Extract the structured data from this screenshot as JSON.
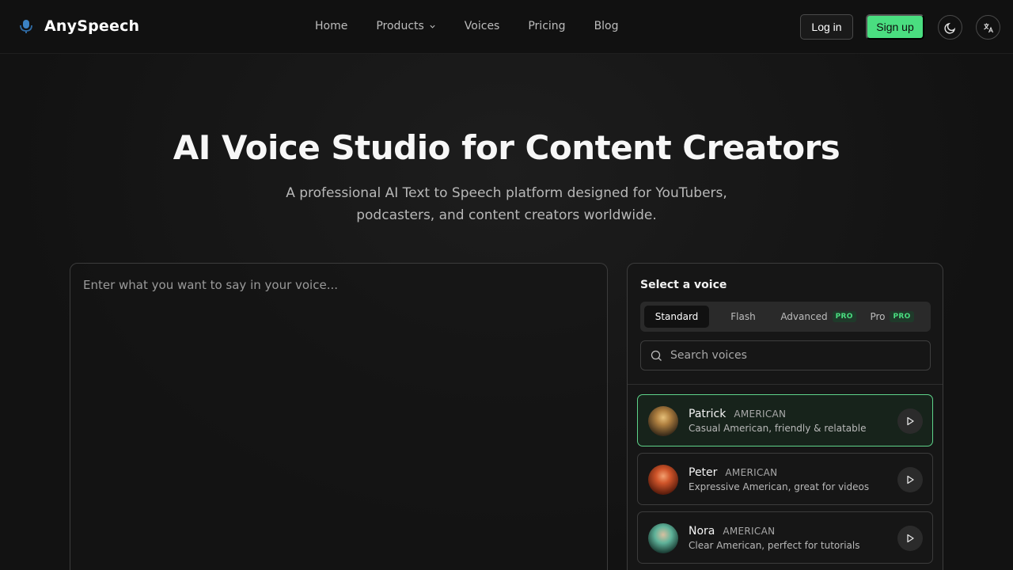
{
  "brand": {
    "name": "AnySpeech",
    "accent": "#4ade80"
  },
  "nav": {
    "items": [
      {
        "label": "Home"
      },
      {
        "label": "Products",
        "has_dropdown": true
      },
      {
        "label": "Voices"
      },
      {
        "label": "Pricing"
      },
      {
        "label": "Blog"
      }
    ]
  },
  "auth": {
    "login_label": "Log in",
    "signup_label": "Sign up"
  },
  "header_icons": {
    "theme": "moon-icon",
    "language": "translate-icon"
  },
  "hero": {
    "title": "AI Voice Studio for Content Creators",
    "subtitle": "A professional AI Text to Speech platform designed for YouTubers, podcasters, and content creators worldwide."
  },
  "editor": {
    "placeholder": "Enter what you want to say in your voice...",
    "value": ""
  },
  "voice_panel": {
    "title": "Select a voice",
    "tabs": [
      {
        "label": "Standard",
        "active": true,
        "badge": ""
      },
      {
        "label": "Flash",
        "active": false,
        "badge": ""
      },
      {
        "label": "Advanced",
        "active": false,
        "badge": "PRO"
      },
      {
        "label": "Pro",
        "active": false,
        "badge": "PRO"
      }
    ],
    "search_placeholder": "Search voices",
    "voices": [
      {
        "name": "Patrick",
        "accent": "AMERICAN",
        "description": "Casual American, friendly & relatable",
        "selected": true,
        "avatar_colors": [
          "#c9a35a",
          "#3b2c1a"
        ]
      },
      {
        "name": "Peter",
        "accent": "AMERICAN",
        "description": "Expressive American, great for videos",
        "selected": false,
        "avatar_colors": [
          "#e0662b",
          "#5a1c0c"
        ]
      },
      {
        "name": "Nora",
        "accent": "AMERICAN",
        "description": "Clear American, perfect for tutorials",
        "selected": false,
        "avatar_colors": [
          "#5fb39a",
          "#1c3f36"
        ]
      }
    ]
  }
}
